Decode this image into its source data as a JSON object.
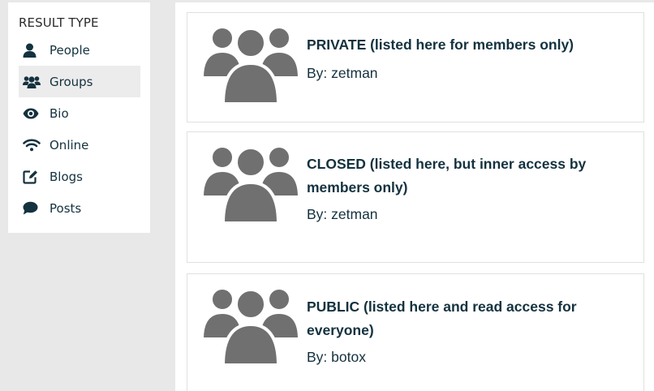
{
  "sidebar": {
    "title": "RESULT TYPE",
    "items": [
      {
        "label": "People",
        "icon": "user-icon",
        "active": false
      },
      {
        "label": "Groups",
        "icon": "users-icon",
        "active": true
      },
      {
        "label": "Bio",
        "icon": "eye-icon",
        "active": false
      },
      {
        "label": "Online",
        "icon": "wifi-icon",
        "active": false
      },
      {
        "label": "Blogs",
        "icon": "edit-icon",
        "active": false
      },
      {
        "label": "Posts",
        "icon": "comment-icon",
        "active": false
      }
    ]
  },
  "results": [
    {
      "title": "PRIVATE (listed here for members only)",
      "by": "By: zetman",
      "icon": "group-avatar-icon"
    },
    {
      "title": "CLOSED (listed here, but inner access by members only)",
      "by": "By: zetman",
      "icon": "group-avatar-icon"
    },
    {
      "title": "PUBLIC (listed here and read access for everyone)",
      "by": "By: botox",
      "icon": "group-avatar-icon"
    }
  ],
  "colors": {
    "background": "#e8e8e8",
    "panel": "#ffffff",
    "text": "#14323f",
    "active_item": "#ececec",
    "avatar": "#707070"
  }
}
